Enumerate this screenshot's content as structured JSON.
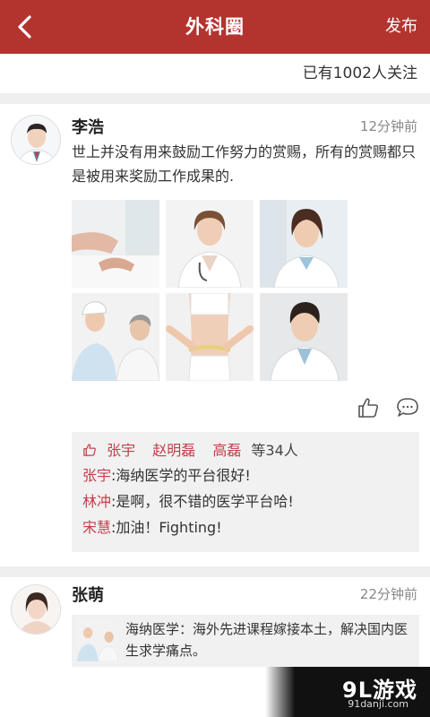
{
  "header": {
    "title": "外科圈",
    "publish_label": "发布"
  },
  "follow": {
    "count_text": "已有1002人关注"
  },
  "posts": [
    {
      "user": "李浩",
      "time": "12分钟前",
      "content": "世上并没有用来鼓励工作努力的赏赐，所有的赏赐都只是被用来奖励工作成果的.",
      "likes": {
        "names": [
          "张宇",
          "赵明磊",
          "高磊"
        ],
        "summary": "等34人"
      },
      "comments": [
        {
          "name": "张宇",
          "text": ":海纳医学的平台很好!"
        },
        {
          "name": "林冲",
          "text": ":是啊，很不错的医学平台哈!"
        },
        {
          "name": "宋慧",
          "text": ":加油！Fighting!"
        }
      ]
    },
    {
      "user": "张萌",
      "time": "22分钟前",
      "shared": {
        "text": "海纳医学：海外先进课程嫁接本土，解决国内医生求学痛点。"
      }
    }
  ],
  "watermark": {
    "main": "9L游戏",
    "sub": "91danji.com"
  },
  "colors": {
    "header": "#b3342f",
    "accent_name": "#c3404b"
  }
}
